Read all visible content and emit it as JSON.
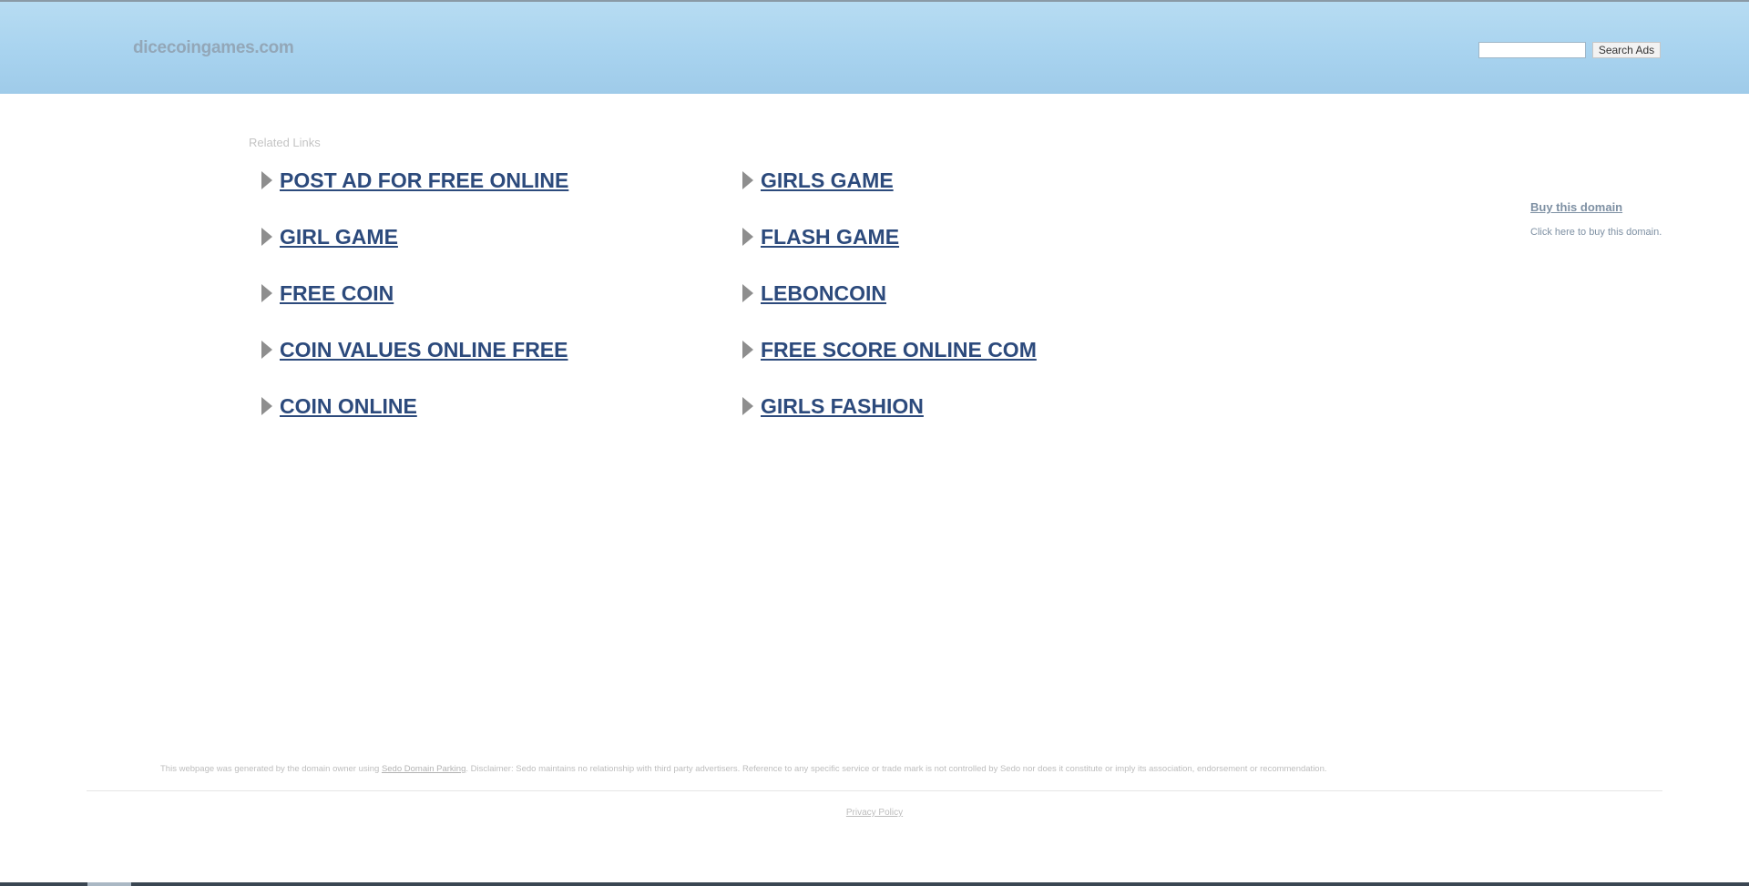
{
  "header": {
    "site_title": "dicecoingames.com",
    "search_placeholder": "",
    "search_button": "Search Ads"
  },
  "related": {
    "heading": "Related Links",
    "left_links": [
      "POST AD FOR FREE ONLINE",
      "GIRL GAME",
      "FREE COIN",
      "COIN VALUES ONLINE FREE",
      "COIN ONLINE"
    ],
    "right_links": [
      "GIRLS GAME",
      "FLASH GAME",
      "LEBONCOIN",
      "FREE SCORE ONLINE COM",
      "GIRLS FASHION"
    ]
  },
  "sidebar": {
    "buy_link": "Buy this domain",
    "buy_sub": "Click here to buy this domain."
  },
  "footer": {
    "disclaimer_prefix": "This webpage was generated by the domain owner using ",
    "disclaimer_link": "Sedo Domain Parking",
    "disclaimer_suffix": ". Disclaimer: Sedo maintains no relationship with third party advertisers. Reference to any specific service or trade mark is not controlled by Sedo nor does it constitute or imply its association, endorsement or recommendation.",
    "privacy": "Privacy Policy"
  },
  "colors": {
    "header_blue": "#a8d3ef",
    "link_blue": "#2c4a7c"
  }
}
